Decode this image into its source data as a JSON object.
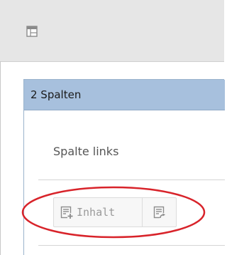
{
  "container": {
    "title": "2 Spalten"
  },
  "column": {
    "title": "Spalte links"
  },
  "actions": {
    "add_content_label": "Inhalt",
    "add_content_icon": "add-content-icon",
    "paste_icon": "paste-content-icon"
  },
  "header": {
    "icon": "layout-icon"
  },
  "annotation": {
    "color": "#d8232a"
  }
}
